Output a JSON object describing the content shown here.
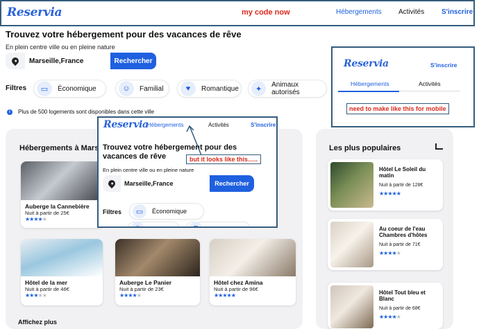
{
  "topbar": {
    "logo": "Reservia",
    "annotation": "my code now",
    "nav": [
      "Hébergements",
      "Activités"
    ],
    "signup": "S'inscrire"
  },
  "hero": {
    "title": "Trouvez votre hébergement pour des vacances de rêve",
    "subtitle": "En plein centre ville ou en pleine nature",
    "search_value": "Marseille,France",
    "search_button": "Rechercher"
  },
  "filters": {
    "label": "Filtres",
    "items": [
      {
        "label": "Économique",
        "icon": "money-icon"
      },
      {
        "label": "Familial",
        "icon": "family-icon"
      },
      {
        "label": "Romantique",
        "icon": "heart-icon"
      },
      {
        "label": "Animaux autorisés",
        "icon": "dog-icon"
      }
    ]
  },
  "info": "Plus de 500 logements sont disponibles dans cette ville",
  "lodgings": {
    "title": "Hébergements à Marseille",
    "more": "Affichez plus",
    "cards": [
      {
        "name": "Auberge la Cannebière",
        "price": "Nuit à partir de 25€",
        "stars": 4
      },
      {
        "name": "Hôtel de la mer",
        "price": "Nuit à partir de 46€",
        "stars": 3
      },
      {
        "name": "Auberge Le Panier",
        "price": "Nuit à partir de 23€",
        "stars": 4
      },
      {
        "name": "Hôtel chez Amina",
        "price": "Nuit à partir de 96€",
        "stars": 5
      }
    ]
  },
  "popular": {
    "title": "Les plus populaires",
    "items": [
      {
        "name": "Hôtel Le Soleil du matin",
        "price": "Nuit à partir de 128€",
        "stars": 5
      },
      {
        "name": "Au coeur de l'eau Chambres d'hôtes",
        "price": "Nuit à partir de 71€",
        "stars": 4
      },
      {
        "name": "Hôtel Tout bleu et Blanc",
        "price": "Nuit à partir de 68€",
        "stars": 4
      }
    ]
  },
  "mobile_mock": {
    "logo": "Reservia",
    "signup": "S'inscrire",
    "tabs": [
      "Hébergements",
      "Activités"
    ],
    "annotation": "need to make like this for mobile"
  },
  "overlay": {
    "logo": "Reservia",
    "nav": [
      "Hébergements",
      "Activités"
    ],
    "signup": "S'inscrire",
    "title": "Trouvez votre hébergement pour des vacances de rêve",
    "subtitle": "En plein centre ville ou en pleine nature",
    "search_value": "Marseille,France",
    "search_button": "Rechercher",
    "filters_label": "Filtres",
    "filter_first": "Économique",
    "annotation": "but it looks like this….."
  },
  "colors": {
    "accent": "#1f60e0",
    "annotation": "#d92a1c",
    "frame": "#355c7d"
  }
}
